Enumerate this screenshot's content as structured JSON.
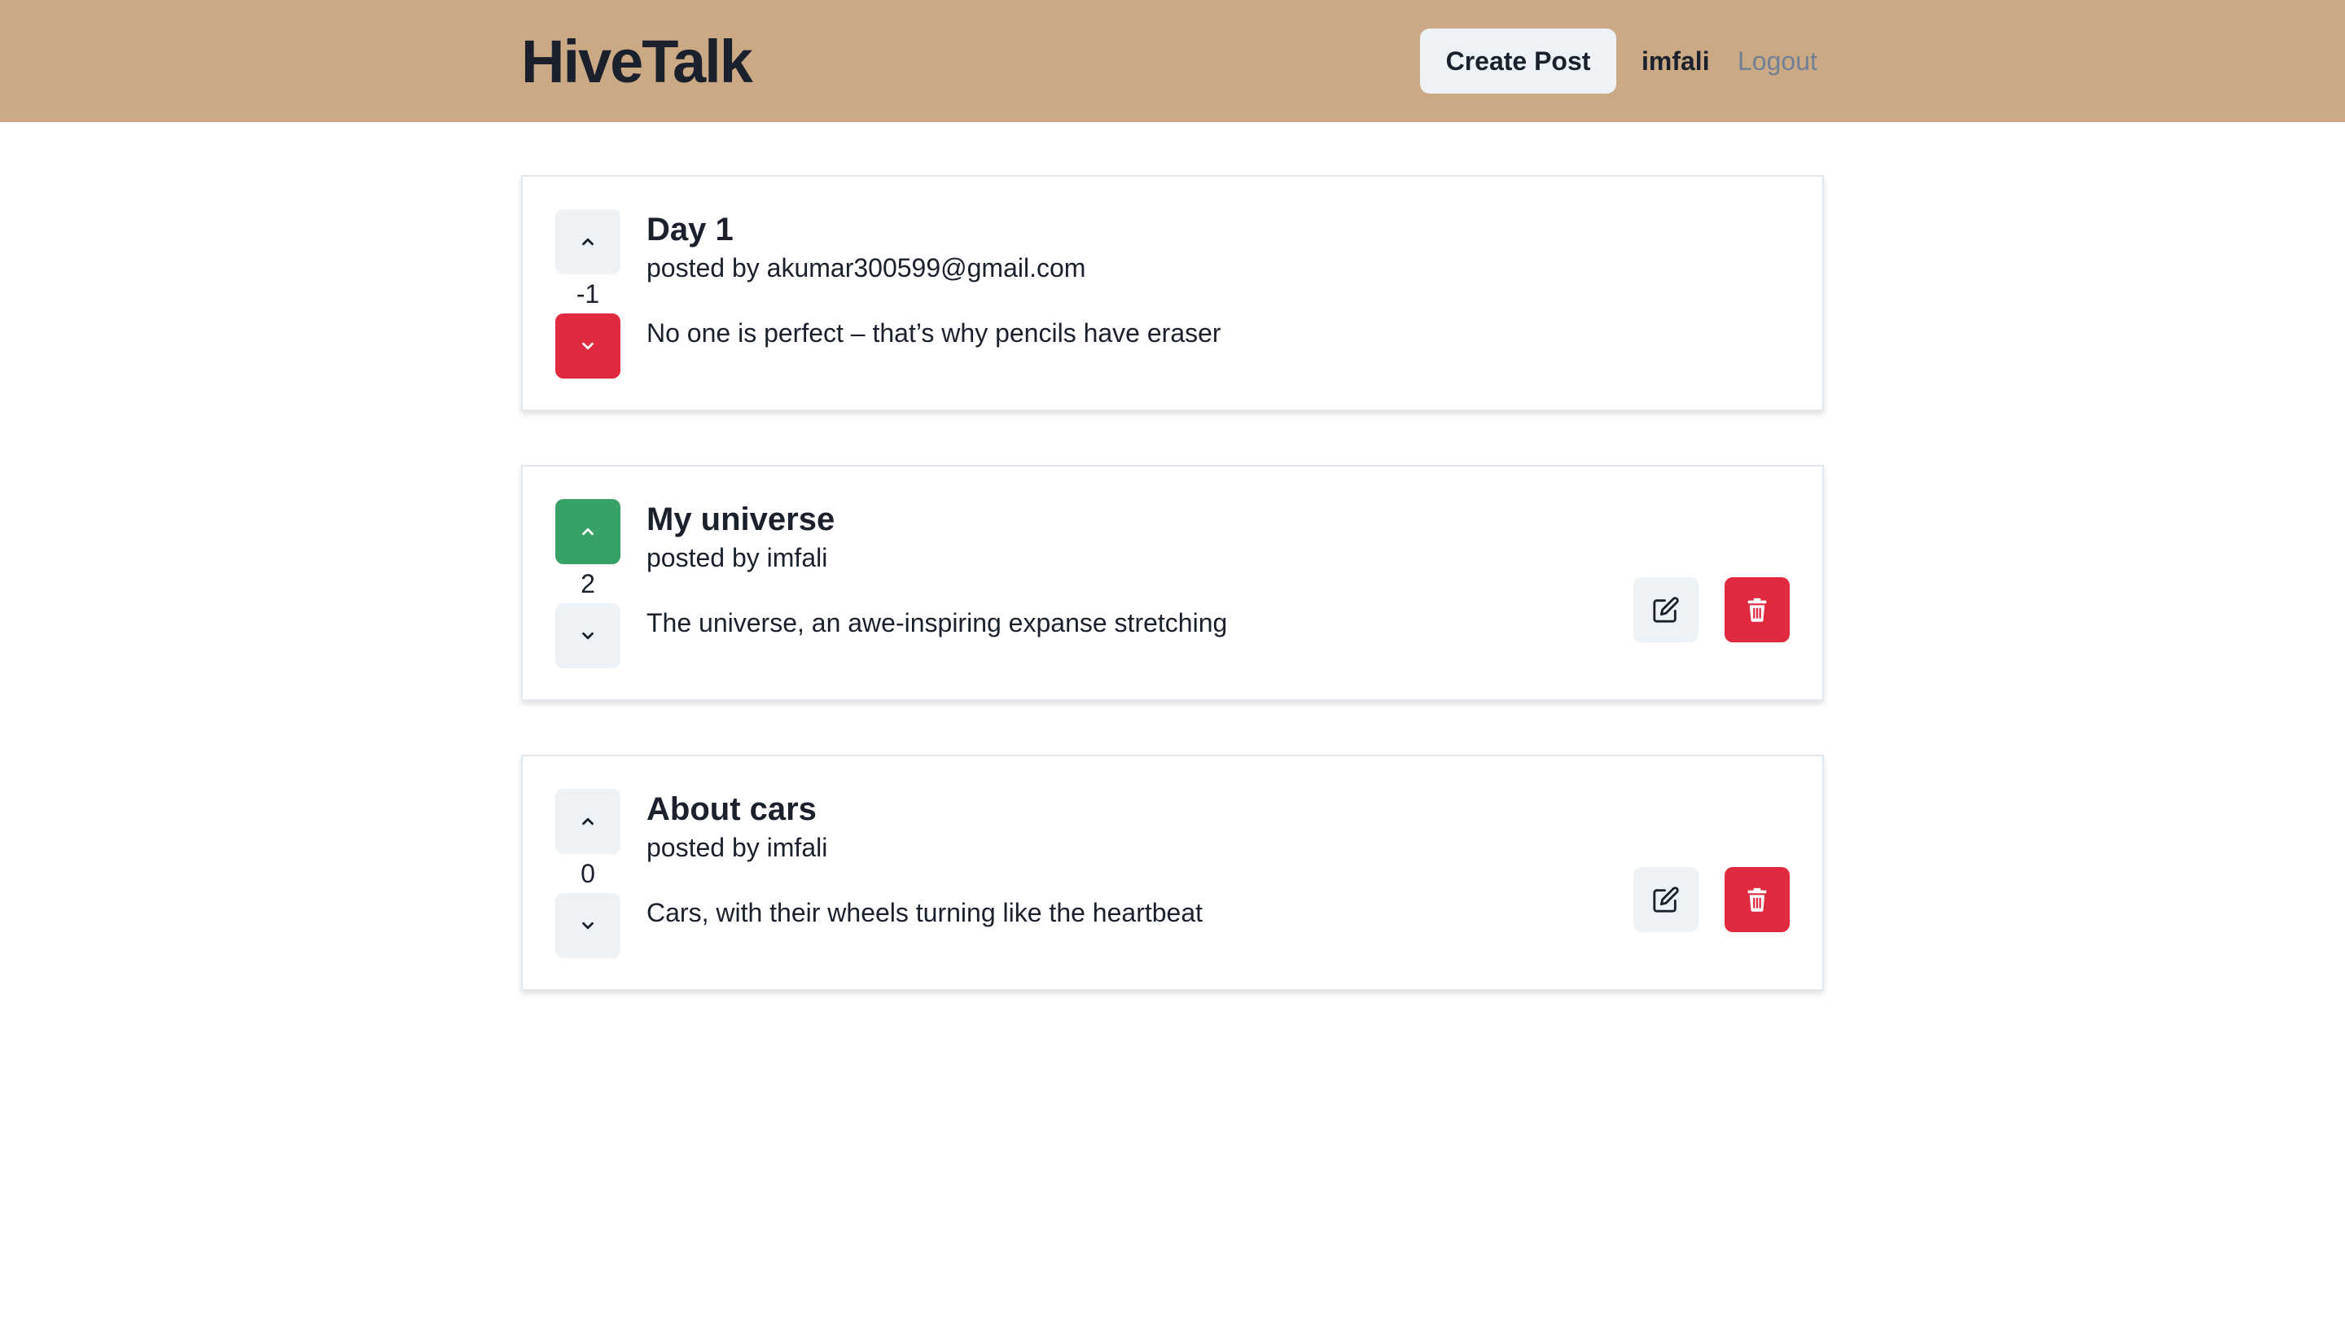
{
  "header": {
    "logo": "HiveTalk",
    "create_post_label": "Create Post",
    "username": "imfali",
    "logout_label": "Logout",
    "background_color": "#cba984"
  },
  "posts": [
    {
      "title": "Day 1",
      "author": "posted by akumar300599@gmail.com",
      "body": "No one is perfect – that’s why pencils have eraser",
      "votes": "-1",
      "vote_state": "down",
      "editable": false
    },
    {
      "title": "My universe",
      "author": "posted by imfali",
      "body": "The universe, an awe-inspiring expanse stretching",
      "votes": "2",
      "vote_state": "up",
      "editable": true
    },
    {
      "title": "About cars",
      "author": "posted by imfali",
      "body": "Cars, with their wheels turning like the heartbeat",
      "votes": "0",
      "vote_state": "none",
      "editable": true
    }
  ],
  "icons": {
    "upvote": "chevron-up-icon",
    "downvote": "chevron-down-icon",
    "edit": "edit-icon",
    "delete": "trash-icon"
  },
  "colors": {
    "upvote_active": "#38a169",
    "downvote_active": "#e02a3f",
    "delete_button": "#e02a3f",
    "neutral_button": "#edf2f7"
  }
}
